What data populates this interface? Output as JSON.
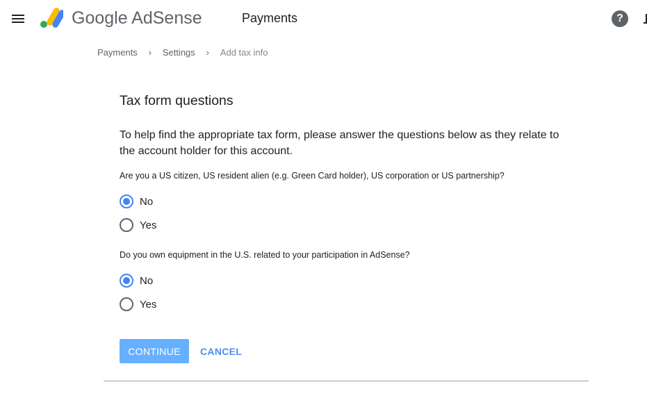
{
  "header": {
    "product_name": "Google AdSense",
    "page_title": "Payments"
  },
  "breadcrumb": [
    {
      "label": "Payments"
    },
    {
      "label": "Settings"
    },
    {
      "label": "Add tax info"
    }
  ],
  "form": {
    "title": "Tax form questions",
    "intro": "To help find the appropriate tax form, please answer the questions below as they relate to the account holder for this account.",
    "questions": [
      {
        "text": "Are you a US citizen, US resident alien (e.g. Green Card holder), US corporation or US partnership?",
        "options": [
          {
            "label": "No",
            "selected": true
          },
          {
            "label": "Yes",
            "selected": false
          }
        ]
      },
      {
        "text": "Do you own equipment in the U.S. related to your participation in AdSense?",
        "options": [
          {
            "label": "No",
            "selected": true
          },
          {
            "label": "Yes",
            "selected": false
          }
        ]
      }
    ],
    "continue_label": "CONTINUE",
    "cancel_label": "CANCEL"
  },
  "colors": {
    "accent": "#4285f4",
    "continue_bg": "#66b0ff",
    "cancel_text": "#4c8fe8"
  },
  "icons": {
    "menu": "menu-icon",
    "logo": "adsense-logo-icon",
    "help": "help-icon",
    "breadcrumb_separator": "chevron-right-icon"
  }
}
